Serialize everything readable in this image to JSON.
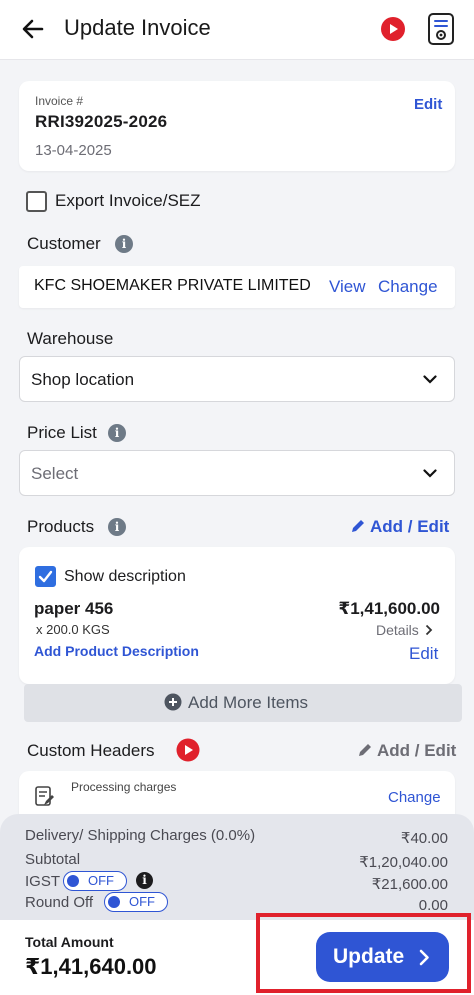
{
  "header": {
    "title": "Update Invoice",
    "icons": {
      "back": "back-arrow-icon",
      "video": "youtube-play-icon",
      "doc": "invoice-settings-icon"
    }
  },
  "invoice": {
    "label": "Invoice #",
    "number": "RRI392025-2026",
    "date": "13-04-2025",
    "edit_label": "Edit"
  },
  "export": {
    "label": "Export Invoice/SEZ",
    "checked": false
  },
  "customer": {
    "label": "Customer",
    "name": "KFC SHOEMAKER PRIVATE LIMITED",
    "view_label": "View",
    "change_label": "Change"
  },
  "warehouse": {
    "label": "Warehouse",
    "value": "Shop location"
  },
  "price_list": {
    "label": "Price List",
    "placeholder": "Select"
  },
  "products": {
    "label": "Products",
    "add_edit_label": "Add / Edit",
    "show_description_label": "Show description",
    "show_description_checked": true,
    "items": [
      {
        "name": "paper 456",
        "qty": "x 200.0 KGS",
        "amount": "₹1,41,600.00",
        "details_label": "Details",
        "add_description_label": "Add Product Description",
        "edit_label": "Edit"
      }
    ],
    "add_more_label": "Add More Items"
  },
  "custom_headers": {
    "label": "Custom Headers",
    "add_edit_label": "Add / Edit",
    "item_label": "Processing charges",
    "change_label": "Change"
  },
  "summary": {
    "delivery_label": "Delivery/ Shipping Charges (0.0%)",
    "delivery_value": "₹40.00",
    "subtotal_label": "Subtotal",
    "subtotal_value": "₹1,20,040.00",
    "igst_label": "IGST",
    "igst_toggle": "OFF",
    "igst_value": "₹21,600.00",
    "roundoff_label": "Round Off",
    "roundoff_toggle": "OFF",
    "roundoff_value": "0.00"
  },
  "footer": {
    "total_label": "Total Amount",
    "total_value": "₹1,41,640.00",
    "update_label": "Update"
  },
  "colors": {
    "accent": "#2f55d4",
    "highlight_box": "#e0212c",
    "youtube": "#e0212c"
  }
}
